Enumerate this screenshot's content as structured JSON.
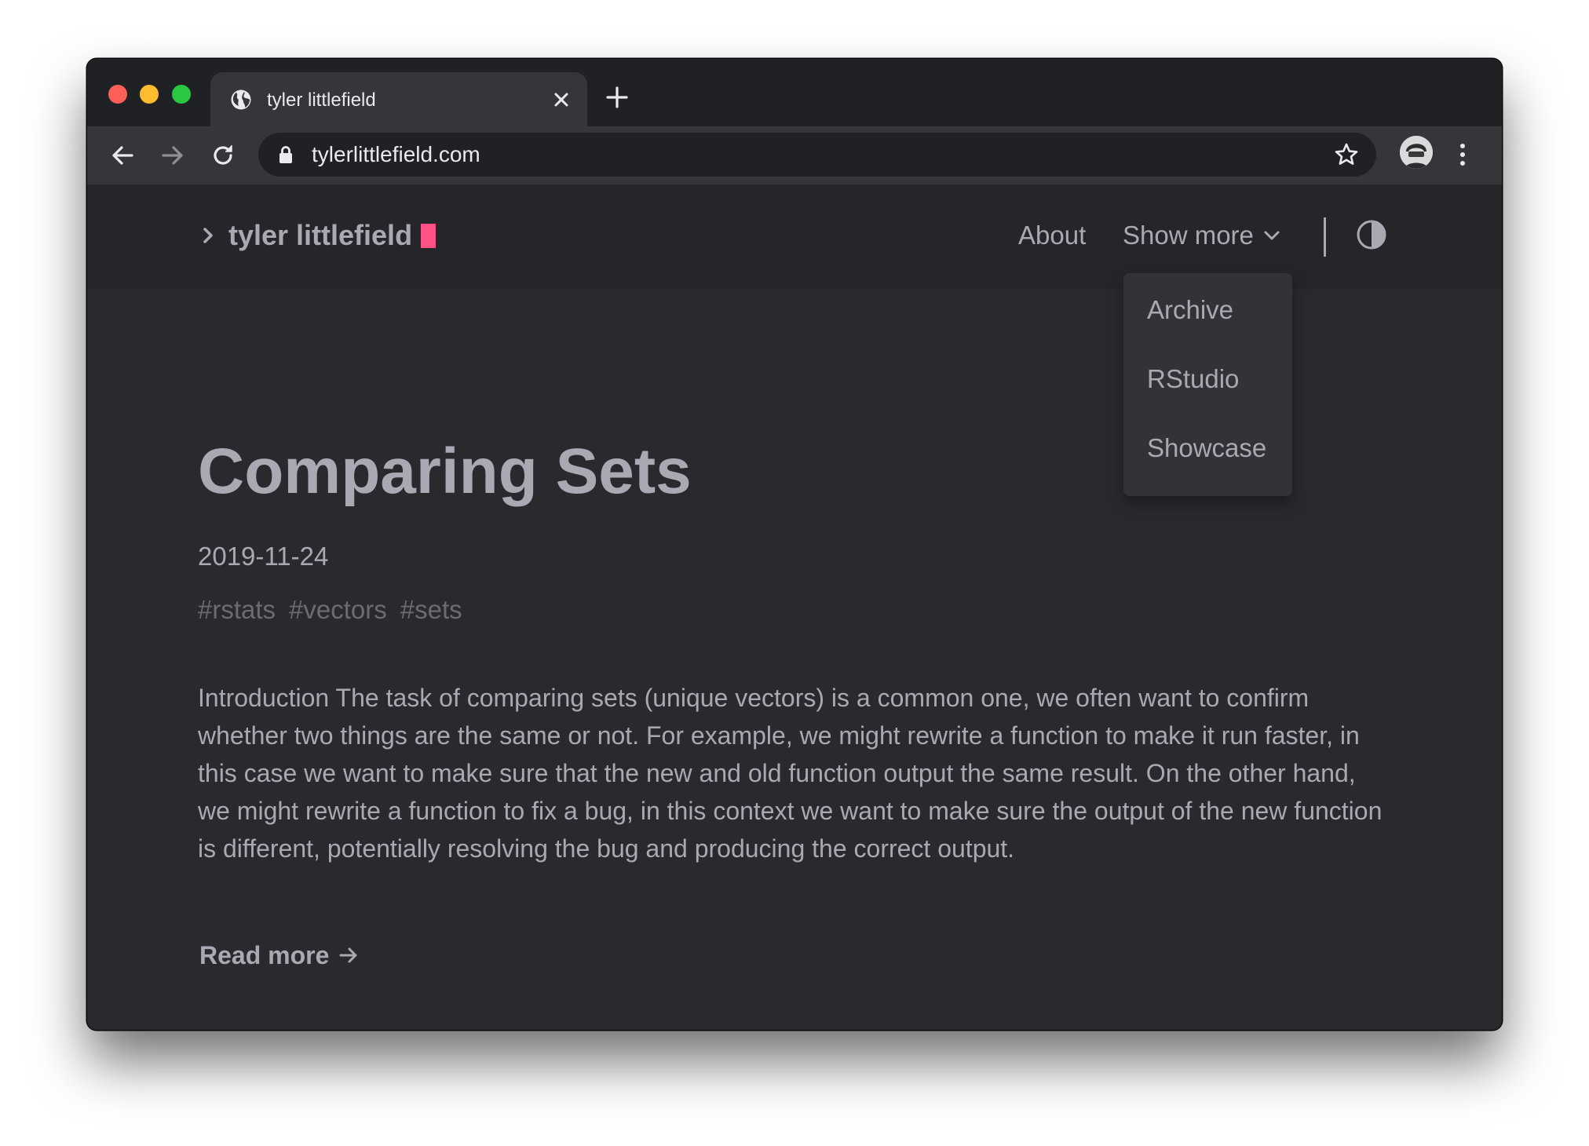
{
  "browser": {
    "tab_title": "tyler littlefield",
    "url": "tylerlittlefield.com"
  },
  "site": {
    "logo_text": "tyler littlefield",
    "accent_color": "#fe5186",
    "nav": {
      "about": "About",
      "show_more": "Show more"
    },
    "dropdown": [
      "Archive",
      "RStudio",
      "Showcase"
    ]
  },
  "post": {
    "title": "Comparing Sets",
    "date": "2019-11-24",
    "tags": [
      "#rstats",
      "#vectors",
      "#sets"
    ],
    "excerpt": "Introduction The task of comparing sets (unique vectors) is a common one, we often want to confirm whether two things are the same or not. For example, we might rewrite a function to make it run faster, in this case we want to make sure that the new and old function output the same result. On the other hand, we might rewrite a function to fix a bug, in this context we want to make sure the output of the new function is different, potentially resolving the bug and producing the correct output.",
    "read_more": "Read more"
  },
  "icons": {
    "tab": "globe-icon",
    "close": "close-icon",
    "new_tab": "plus-icon",
    "back": "arrow-left-icon",
    "forward": "arrow-right-icon",
    "reload": "reload-icon",
    "lock": "lock-icon",
    "bookmark": "star-icon",
    "profile": "avatar",
    "menu": "kebab-menu-icon",
    "theme": "contrast-icon"
  }
}
